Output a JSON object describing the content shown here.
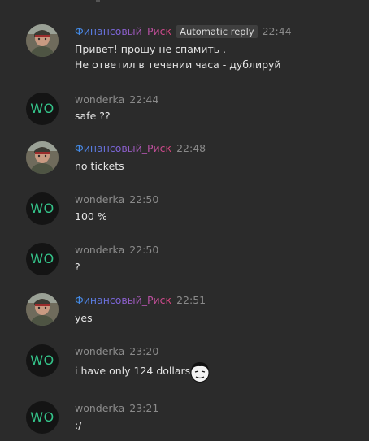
{
  "messages": [
    {
      "author": "Финансовый_Риск",
      "avatar_kind": "photo",
      "badge": "Automatic reply",
      "time": "22:44",
      "lines": [
        "Привет! прошу не спамить .",
        "Не ответил в течении часа - дублируй"
      ]
    },
    {
      "author": "wonderka",
      "avatar_kind": "initials",
      "avatar_text": "WO",
      "time": "22:44",
      "lines": [
        "safe ??"
      ]
    },
    {
      "author": "Финансовый_Риск",
      "avatar_kind": "photo",
      "time": "22:48",
      "lines": [
        "no tickets"
      ]
    },
    {
      "author": "wonderka",
      "avatar_kind": "initials",
      "avatar_text": "WO",
      "time": "22:50",
      "lines": [
        "100 %"
      ]
    },
    {
      "author": "wonderka",
      "avatar_kind": "initials",
      "avatar_text": "WO",
      "time": "22:50",
      "lines": [
        "?"
      ]
    },
    {
      "author": "Финансовый_Риск",
      "avatar_kind": "photo",
      "time": "22:51",
      "lines": [
        "yes"
      ]
    },
    {
      "author": "wonderka",
      "avatar_kind": "initials",
      "avatar_text": "WO",
      "time": "23:20",
      "lines": [
        "i have only 124 dollars"
      ],
      "emoji": "meme-face-icon"
    },
    {
      "author": "wonderka",
      "avatar_kind": "initials",
      "avatar_text": "WO",
      "time": "23:21",
      "lines": [
        ":/"
      ]
    }
  ],
  "colors": {
    "background": "#2b2b2b",
    "initials_avatar_bg": "#141414",
    "initials_avatar_text": "#34c48a",
    "name_gradient_start": "#3d8fe8",
    "name_gradient_end": "#e0457f",
    "secondary_text": "#8c8c8c"
  }
}
